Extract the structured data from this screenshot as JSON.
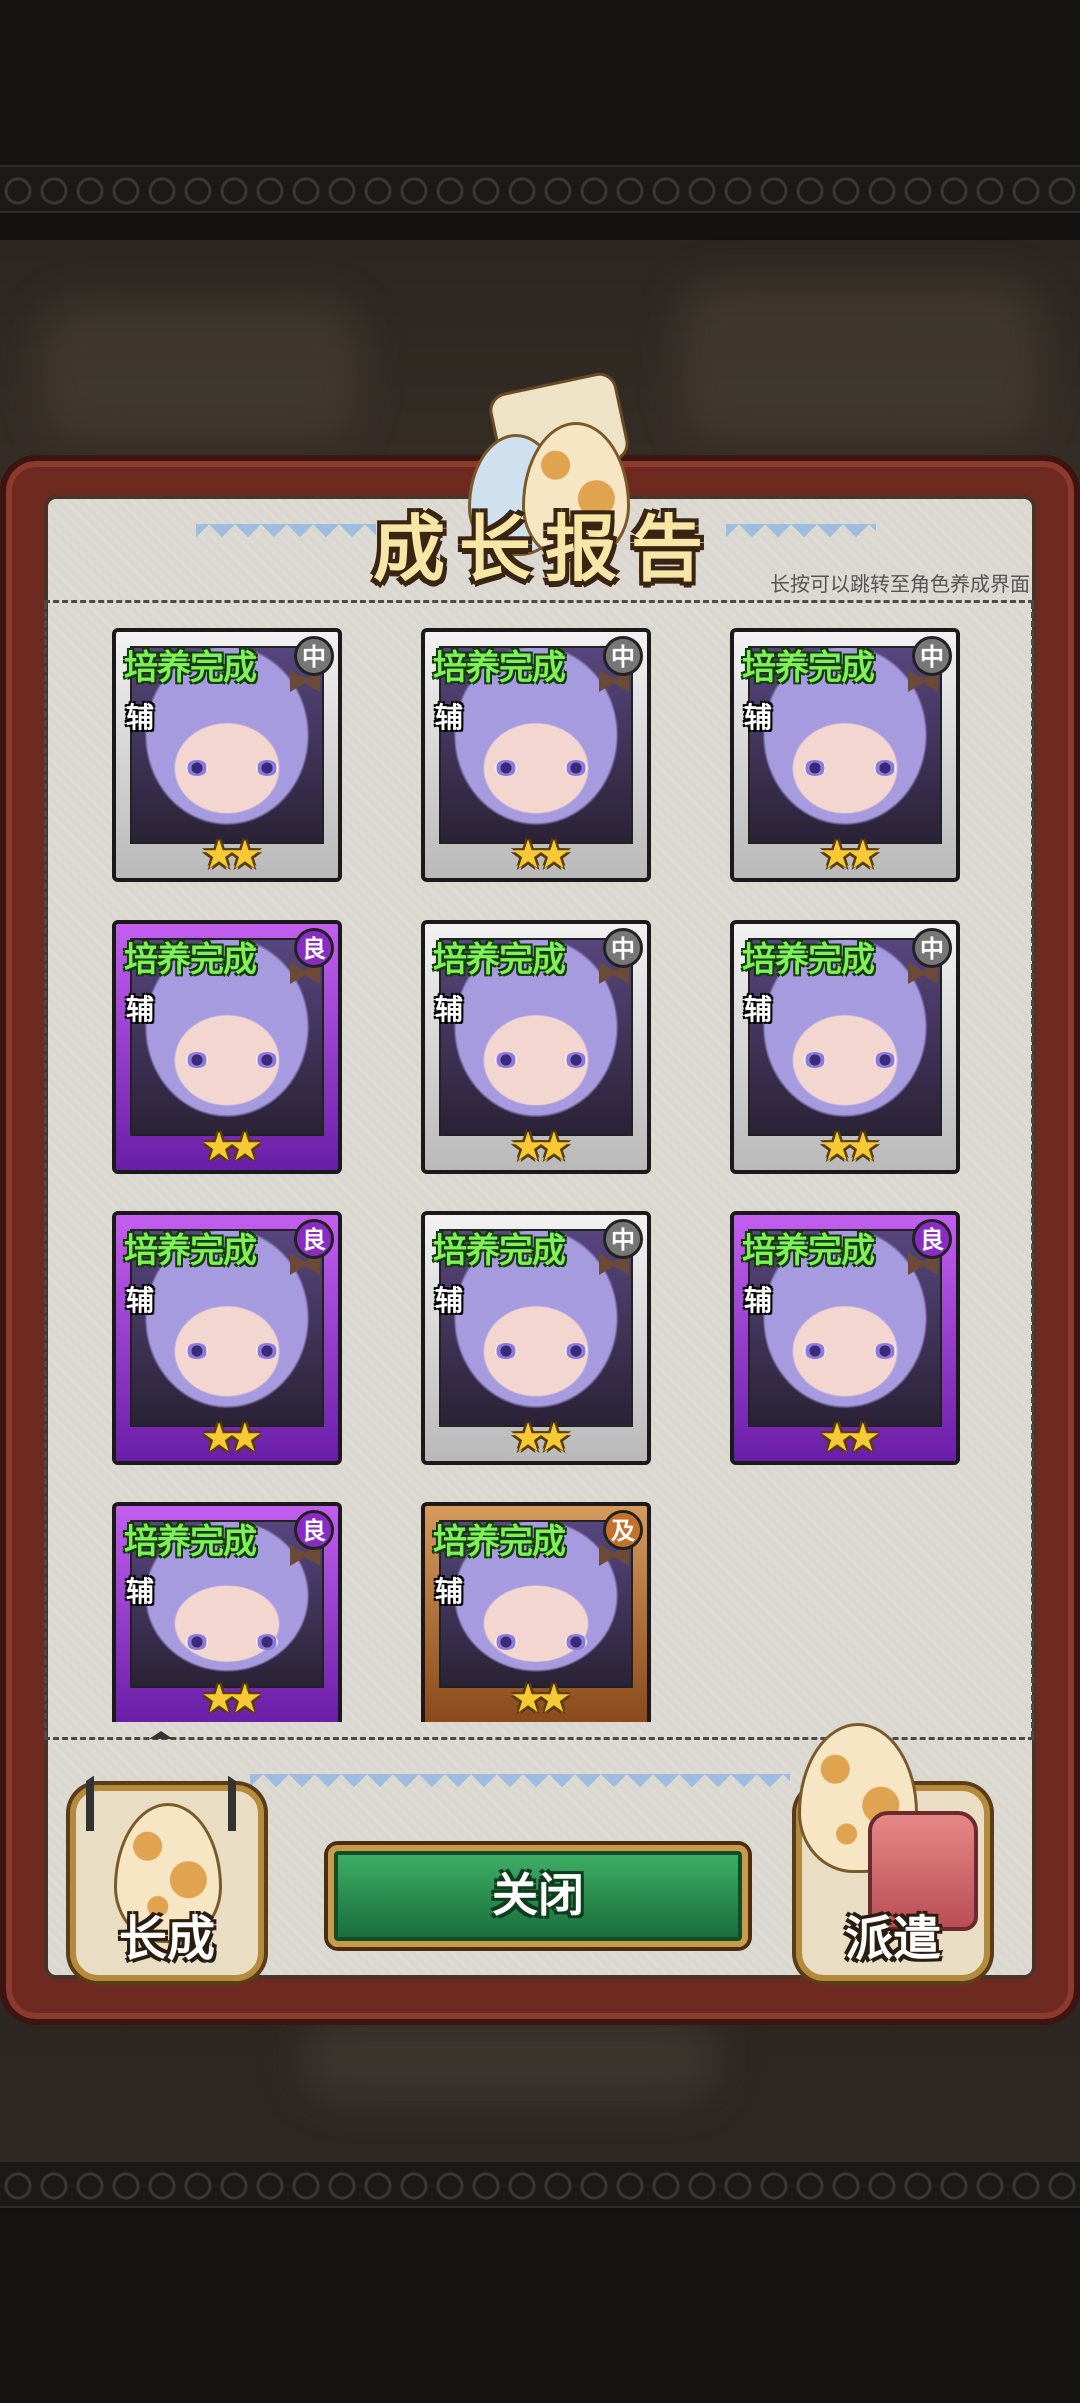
{
  "title": "成长报告",
  "hint": "长按可以跳转至角色养成界面",
  "cards": [
    {
      "title": "培养完成",
      "role": "辅",
      "grade": "中",
      "grade_type": "mid",
      "stars": "★★",
      "frame": "grey"
    },
    {
      "title": "培养完成",
      "role": "辅",
      "grade": "中",
      "grade_type": "mid",
      "stars": "★★",
      "frame": "grey"
    },
    {
      "title": "培养完成",
      "role": "辅",
      "grade": "中",
      "grade_type": "mid",
      "stars": "★★",
      "frame": "grey"
    },
    {
      "title": "培养完成",
      "role": "辅",
      "grade": "良",
      "grade_type": "good",
      "stars": "★★",
      "frame": "purple"
    },
    {
      "title": "培养完成",
      "role": "辅",
      "grade": "中",
      "grade_type": "mid",
      "stars": "★★",
      "frame": "grey"
    },
    {
      "title": "培养完成",
      "role": "辅",
      "grade": "中",
      "grade_type": "mid",
      "stars": "★★",
      "frame": "grey"
    },
    {
      "title": "培养完成",
      "role": "辅",
      "grade": "良",
      "grade_type": "good",
      "stars": "★★",
      "frame": "purple"
    },
    {
      "title": "培养完成",
      "role": "辅",
      "grade": "中",
      "grade_type": "mid",
      "stars": "★★",
      "frame": "grey"
    },
    {
      "title": "培养完成",
      "role": "辅",
      "grade": "良",
      "grade_type": "good",
      "stars": "★★",
      "frame": "purple"
    },
    {
      "title": "培养完成",
      "role": "辅",
      "grade": "良",
      "grade_type": "good",
      "stars": "★★",
      "frame": "purple"
    },
    {
      "title": "培养完成",
      "role": "辅",
      "grade": "及",
      "grade_type": "pass",
      "stars": "★★",
      "frame": "orange"
    }
  ],
  "buttons": {
    "close": "关闭",
    "grow": "长成",
    "dispatch": "派遣"
  },
  "colors": {
    "title_text": "#f7e6a6",
    "card_title_text": "#7ff05a",
    "close_button": "#2a8c4e",
    "panel_frame": "#6e2a20"
  },
  "icons": {
    "title": "egg-scroll-icon",
    "grow": "egg-icon",
    "dispatch": "egg-backpack-icon"
  }
}
